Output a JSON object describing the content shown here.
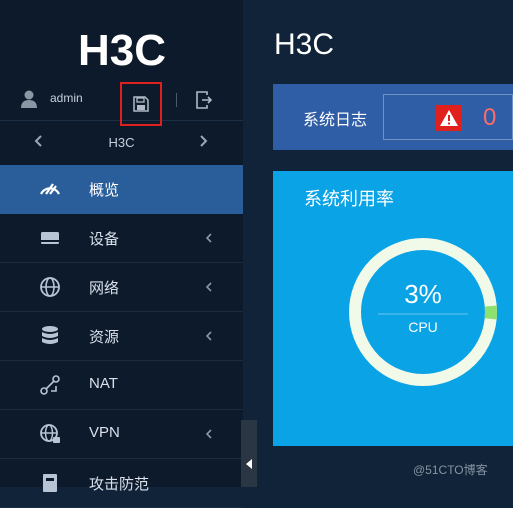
{
  "brand": {
    "logo_text": "H3C"
  },
  "user": {
    "name": "admin"
  },
  "device_switcher": {
    "current": "H3C"
  },
  "menu": [
    {
      "label": "概览",
      "icon": "dashboard-icon",
      "active": true,
      "has_submenu": false
    },
    {
      "label": "设备",
      "icon": "device-icon",
      "active": false,
      "has_submenu": true
    },
    {
      "label": "网络",
      "icon": "globe-icon",
      "active": false,
      "has_submenu": true
    },
    {
      "label": "资源",
      "icon": "database-icon",
      "active": false,
      "has_submenu": true
    },
    {
      "label": "NAT",
      "icon": "nat-icon",
      "active": false,
      "has_submenu": false
    },
    {
      "label": "VPN",
      "icon": "vpn-globe-icon",
      "active": false,
      "has_submenu": true
    },
    {
      "label": "攻击防范",
      "icon": "security-icon",
      "active": false,
      "has_submenu": false
    }
  ],
  "main": {
    "title": "H3C",
    "system_log": {
      "label": "系统日志",
      "count": "0"
    },
    "usage": {
      "title": "系统利用率",
      "cpu_value": "3%",
      "cpu_label": "CPU",
      "cpu_percent": 3
    }
  },
  "watermark": "@51CTO博客",
  "colors": {
    "sidebar_bg": "#0d1a2b",
    "active_item": "#2a5e9a",
    "log_panel": "#2f5ea7",
    "usage_panel": "#0aa3e6",
    "gauge_track": "#f1f9e8",
    "gauge_fill": "#8ee06f",
    "alert_red": "#e0201c",
    "count_red": "#ff6a6a"
  }
}
